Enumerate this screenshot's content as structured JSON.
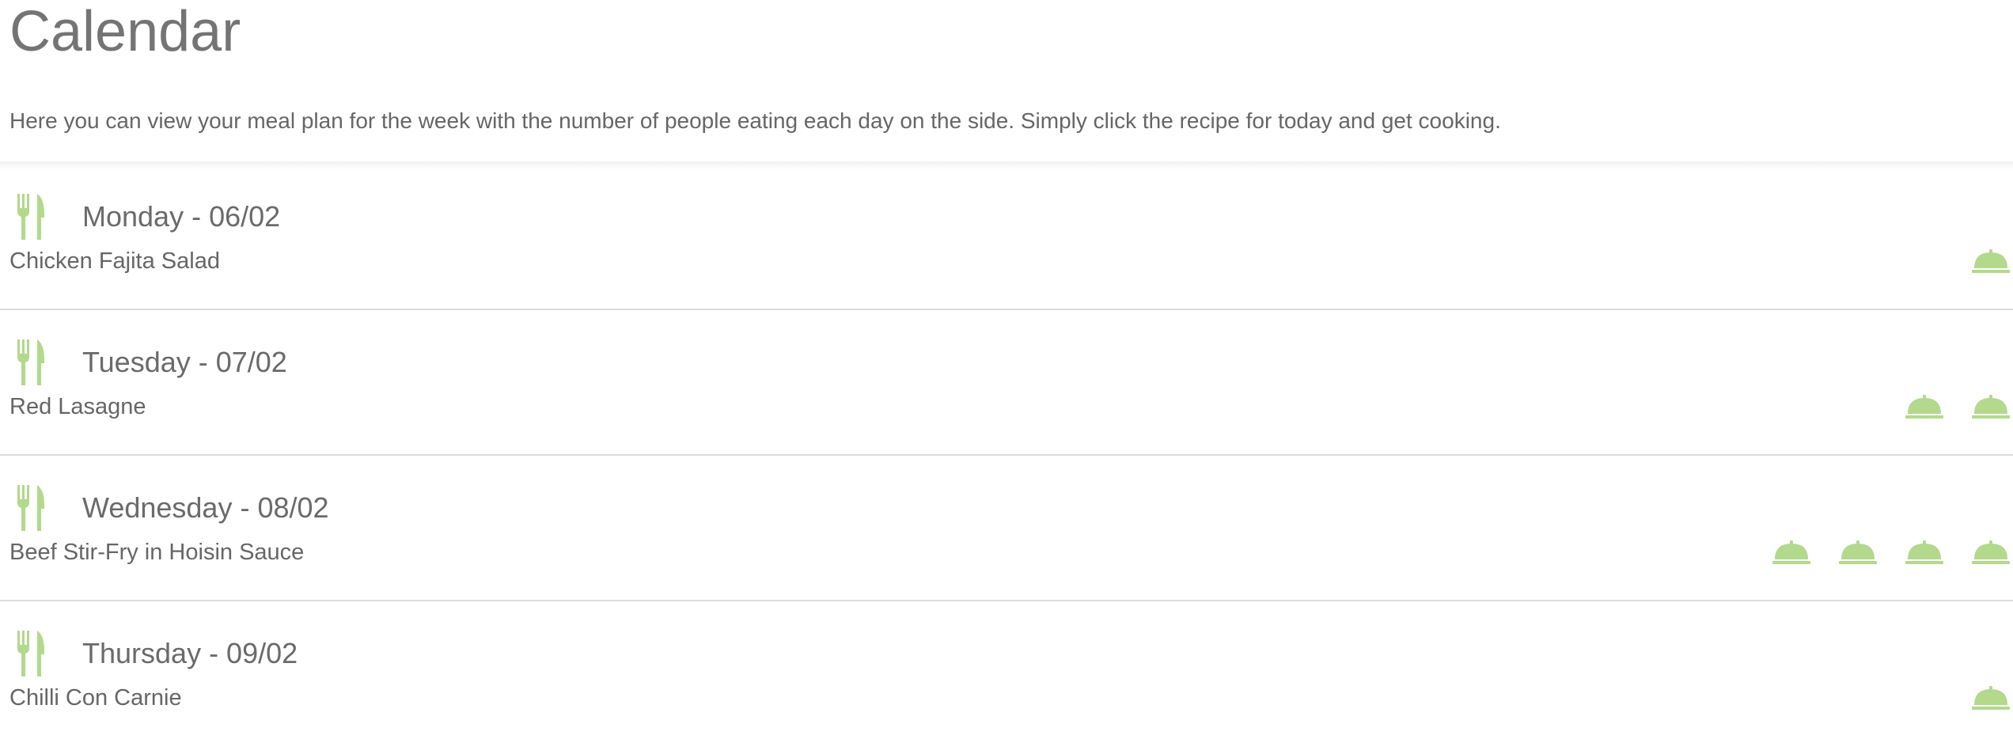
{
  "header": {
    "title": "Calendar",
    "intro": "Here you can view your meal plan for the week with the number of people eating each day on the side. Simply click the recipe for today and get cooking."
  },
  "colors": {
    "accent_green": "#b2d98c",
    "text": "#6f6f6f",
    "divider": "#dcdcdc"
  },
  "icons": {
    "day_icon": "cutlery-icon",
    "person_icon": "cloche-icon"
  },
  "days": [
    {
      "label": "Monday - 06/02",
      "recipe": "Chicken Fajita Salad",
      "people": 1
    },
    {
      "label": "Tuesday - 07/02",
      "recipe": "Red Lasagne",
      "people": 2
    },
    {
      "label": "Wednesday - 08/02",
      "recipe": "Beef Stir-Fry in Hoisin Sauce",
      "people": 4
    },
    {
      "label": "Thursday - 09/02",
      "recipe": "Chilli Con Carnie",
      "people": 1
    }
  ]
}
